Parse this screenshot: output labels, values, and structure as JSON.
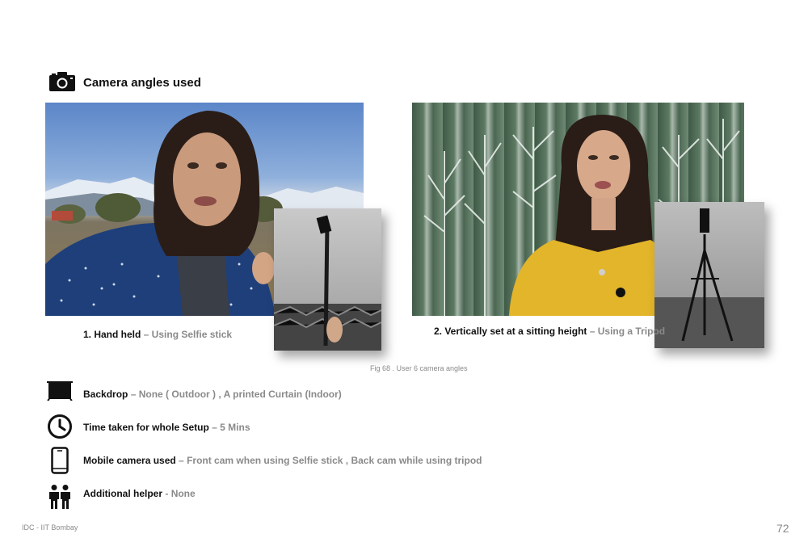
{
  "header": {
    "title": "Camera angles used",
    "icon": "camera-icon"
  },
  "figure": {
    "photo1": {
      "alt": "handheld-selfie-stick-photo"
    },
    "photo2": {
      "alt": "tripod-sitting-height-photo"
    },
    "caption1": {
      "main": "1. Hand held",
      "sub": " – Using Selfie stick"
    },
    "caption2": {
      "main": "2. Vertically set at a sitting height",
      "sub": " – Using a Tripod"
    },
    "fig_caption": "Fig 68  . User 6 camera angles"
  },
  "details": [
    {
      "icon": "backdrop-icon",
      "label": "Backdrop",
      "sep": "  –  ",
      "value": "None ( Outdoor ) , A printed Curtain (Indoor)"
    },
    {
      "icon": "clock-icon",
      "label": "Time taken for whole Setup",
      "sep": " –  ",
      "value": "5 Mins"
    },
    {
      "icon": "smartphone-icon",
      "label": "Mobile camera used",
      "sep": " – ",
      "value": "Front cam when using Selfie stick  , Back cam while using tripod"
    },
    {
      "icon": "people-icon",
      "label": "Additional helper",
      "sep": " - ",
      "value": "None"
    }
  ],
  "footer": {
    "left": "IDC - IIT Bombay",
    "page": "72"
  },
  "colors": {
    "text": "#111111",
    "muted": "#8a8a8a",
    "background": "#ffffff"
  }
}
